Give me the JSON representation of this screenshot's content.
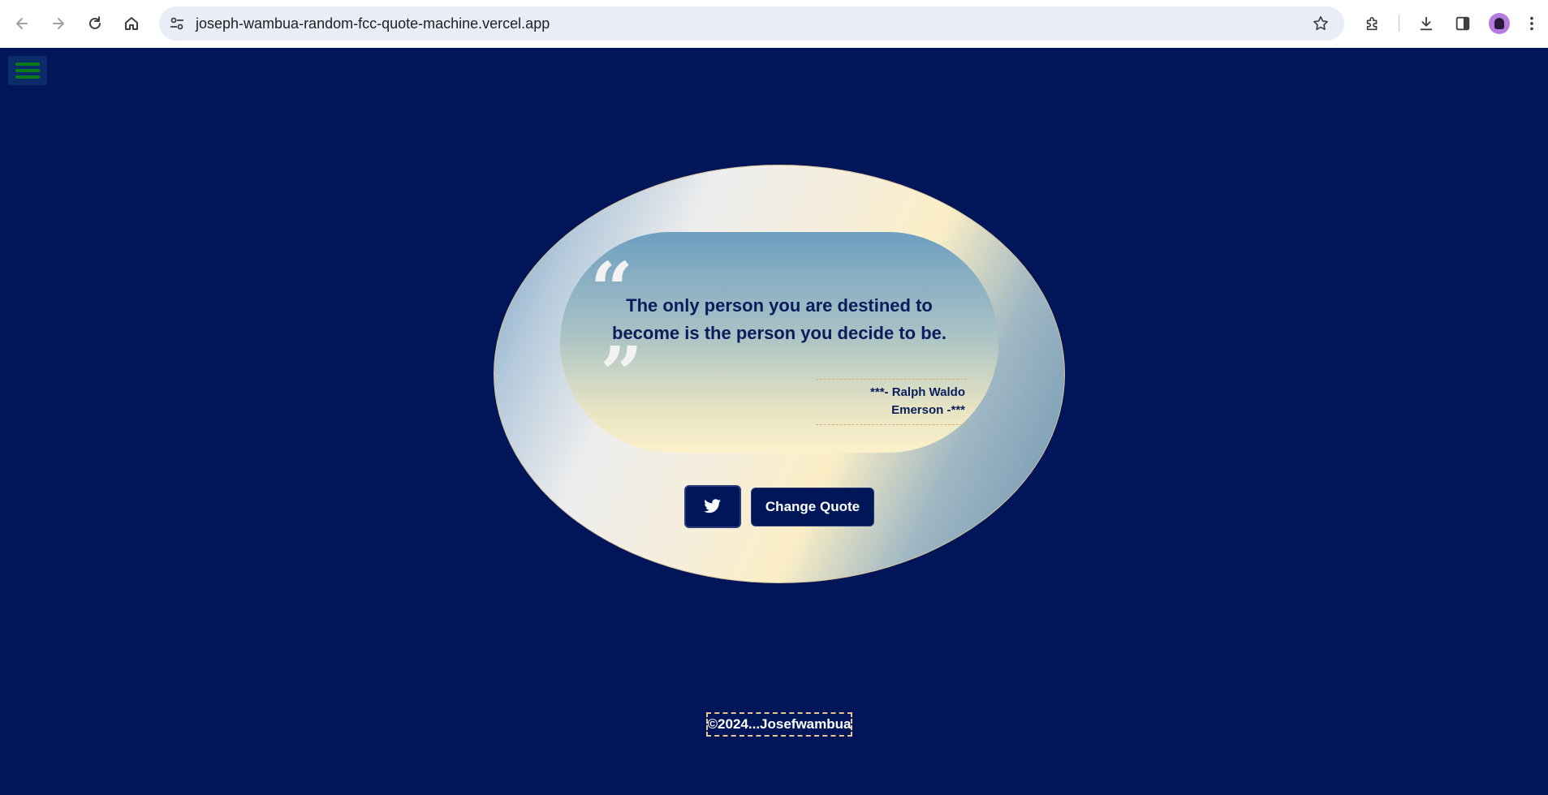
{
  "browser": {
    "url": "joseph-wambua-random-fcc-quote-machine.vercel.app",
    "icons": [
      "back-icon",
      "forward-icon",
      "reload-icon",
      "home-icon",
      "site-info-icon",
      "bookmark-star-icon",
      "extensions-icon",
      "download-icon",
      "side-panel-icon",
      "profile-avatar",
      "more-menu-icon"
    ]
  },
  "app": {
    "menu_icon": "hamburger-icon",
    "quote_text": "The only person you are destined to become is the person you decide to be.",
    "open_mark": "“",
    "close_mark": "”",
    "author": "***- Ralph Waldo Emerson -***",
    "tweet_icon": "twitter-icon",
    "change_label": "Change Quote",
    "footer": "©2024...Josefwambua"
  },
  "colors": {
    "background": "#001659",
    "text": "#0b1c5a",
    "menu_bars": "#0a7a15",
    "accent_border": "#e8c690"
  }
}
